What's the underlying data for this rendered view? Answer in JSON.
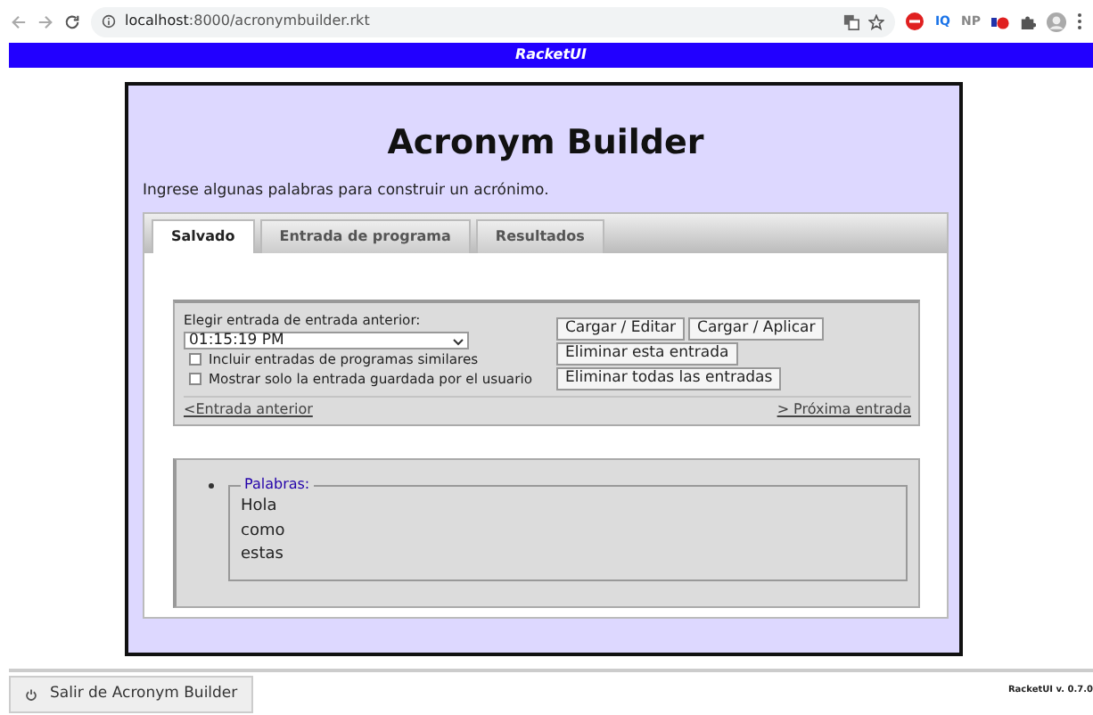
{
  "browser": {
    "url": "**localhost**:8000/acronymbuilder.rkt",
    "extensions": [
      "IQ",
      "NP"
    ]
  },
  "banner": {
    "title": "RacketUI"
  },
  "app": {
    "title": "Acronym Builder",
    "subtitle": "Ingrese algunas palabras para construir un acrónimo.",
    "tabs": [
      {
        "label": "Salvado",
        "selected": true
      },
      {
        "label": "Entrada de programa",
        "selected": false
      },
      {
        "label": "Resultados",
        "selected": false
      }
    ],
    "saved": {
      "choose_label": "Elegir entrada de entrada anterior:",
      "selected_entry": "01:15:19 PM",
      "options": [
        {
          "label": "Incluir entradas de programas similares",
          "checked": false
        },
        {
          "label": "Mostrar solo la entrada guardada por el usuario",
          "checked": false
        }
      ],
      "buttons": [
        [
          "Cargar / Editar",
          "Cargar / Aplicar"
        ],
        [
          "Eliminar esta entrada"
        ],
        [
          "Eliminar todas las entradas"
        ]
      ],
      "prev_link": "<Entrada anterior",
      "next_link": "> Próxima entrada"
    },
    "words": {
      "legend": "Palabras:",
      "items": [
        "Hola",
        "como",
        "estas"
      ]
    }
  },
  "footer": {
    "exit_button": "Salir de Acronym Builder",
    "version": "RacketUI v. 0.7.0"
  }
}
